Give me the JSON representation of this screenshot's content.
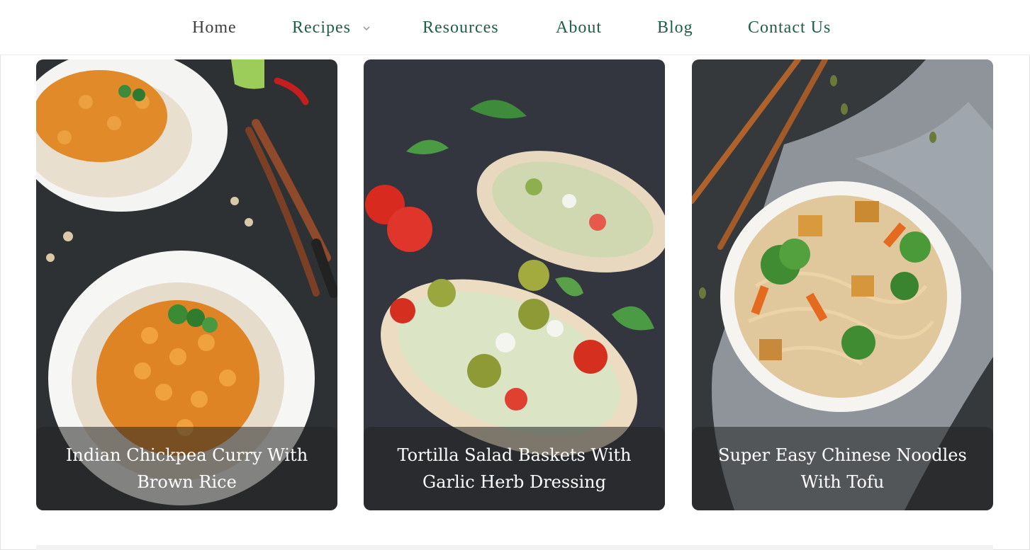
{
  "nav": {
    "items": [
      {
        "label": "Home"
      },
      {
        "label": "Recipes"
      },
      {
        "label": "Resources"
      },
      {
        "label": "About"
      },
      {
        "label": "Blog"
      },
      {
        "label": "Contact Us"
      }
    ]
  },
  "colors": {
    "nav_text": "#1f5e48",
    "nav_active": "#3f3f3f",
    "slate": "#2f3336",
    "caption_overlay": "rgba(35,35,35,0.55)"
  },
  "cards": [
    {
      "title": "Indian Chickpea Curry With Brown Rice",
      "image_icon": "chickpea-curry-photo"
    },
    {
      "title": "Tortilla Salad Baskets With Garlic Herb Dressing",
      "image_icon": "tortilla-salad-photo"
    },
    {
      "title": "Super Easy Chinese Noodles With Tofu",
      "image_icon": "chinese-noodles-photo"
    }
  ]
}
